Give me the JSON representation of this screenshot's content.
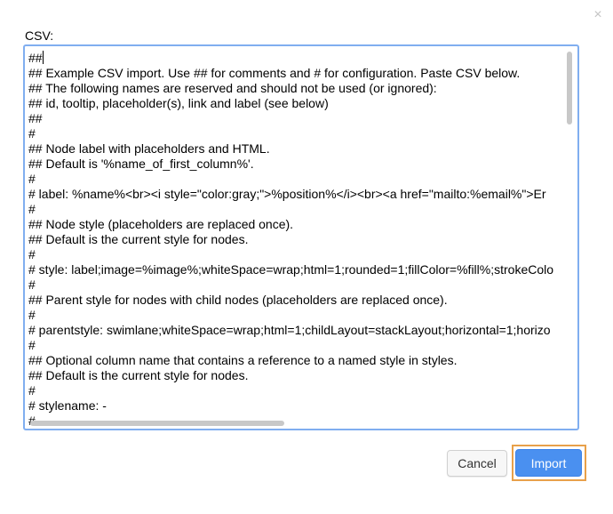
{
  "dialog": {
    "close_glyph": "×",
    "csv_label": "CSV:",
    "csv_lines": [
      "##",
      "## Example CSV import. Use ## for comments and # for configuration. Paste CSV below.",
      "## The following names are reserved and should not be used (or ignored):",
      "## id, tooltip, placeholder(s), link and label (see below)",
      "##",
      "#",
      "## Node label with placeholders and HTML.",
      "## Default is '%name_of_first_column%'.",
      "#",
      "# label: %name%<br><i style=\"color:gray;\">%position%</i><br><a href=\"mailto:%email%\">Er",
      "#",
      "## Node style (placeholders are replaced once).",
      "## Default is the current style for nodes.",
      "#",
      "# style: label;image=%image%;whiteSpace=wrap;html=1;rounded=1;fillColor=%fill%;strokeColo",
      "#",
      "## Parent style for nodes with child nodes (placeholders are replaced once).",
      "#",
      "# parentstyle: swimlane;whiteSpace=wrap;html=1;childLayout=stackLayout;horizontal=1;horizo",
      "#",
      "## Optional column name that contains a reference to a named style in styles.",
      "## Default is the current style for nodes.",
      "#",
      "# stylename: -",
      "#"
    ],
    "cancel_label": "Cancel",
    "import_label": "Import"
  },
  "colors": {
    "primary": "#4a90f0",
    "focus_border": "#80aef0",
    "highlight": "#e8a04a"
  },
  "icons": {
    "close": "close-icon"
  }
}
